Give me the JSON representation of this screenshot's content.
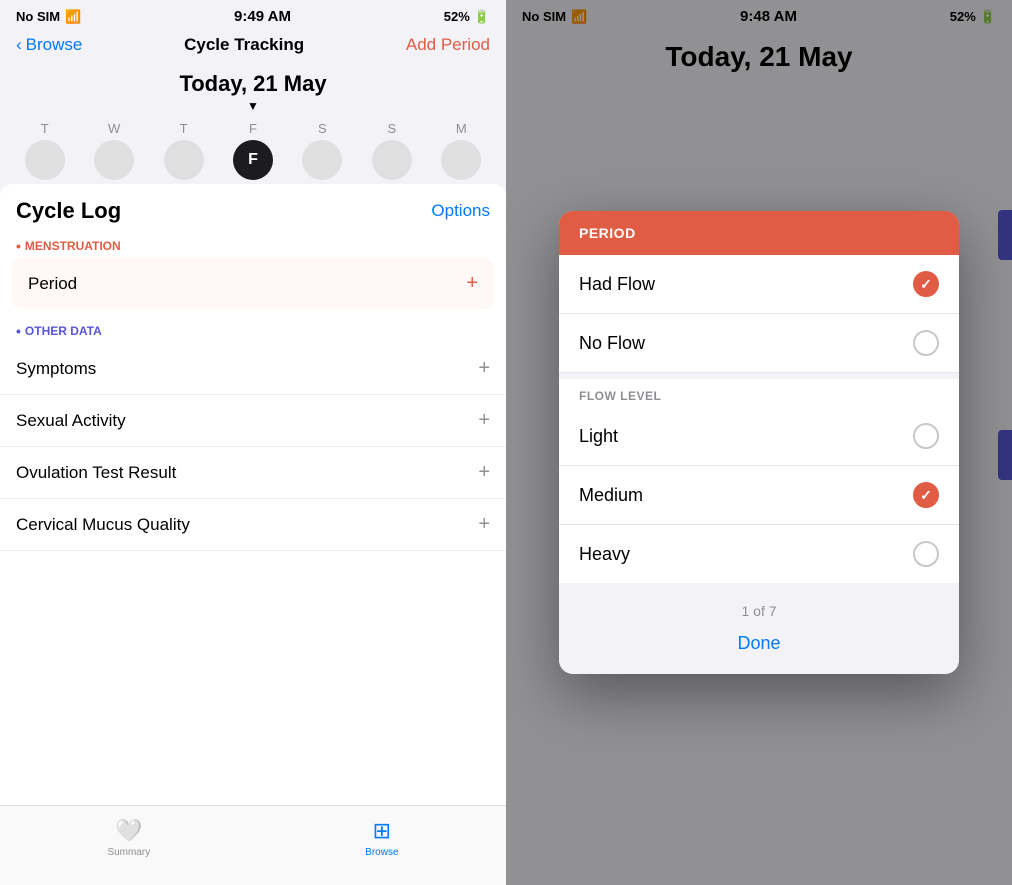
{
  "left": {
    "status": {
      "carrier": "No SIM",
      "time": "9:49 AM",
      "battery": "52%"
    },
    "nav": {
      "back_label": "Browse",
      "title": "Cycle Tracking",
      "action_label": "Add Period"
    },
    "date_header": "Today, 21 May",
    "calendar": {
      "days": [
        "T",
        "W",
        "T",
        "F",
        "S",
        "S",
        "M"
      ],
      "current_day": "F",
      "current_index": 3
    },
    "cycle_log": {
      "title": "Cycle Log",
      "options_label": "Options",
      "menstruation_label": "MENSTRUATION",
      "period_label": "Period",
      "other_data_label": "OTHER DATA",
      "other_items": [
        "Symptoms",
        "Sexual Activity",
        "Ovulation Test Result",
        "Cervical Mucus Quality"
      ]
    },
    "tabs": [
      {
        "label": "Summary",
        "icon": "♥"
      },
      {
        "label": "Browse",
        "icon": "⊞",
        "active": true
      }
    ]
  },
  "right": {
    "status": {
      "carrier": "No SIM",
      "time": "9:48 AM",
      "battery": "52%"
    },
    "date_header": "Today, 21 May",
    "modal": {
      "header_title": "PERIOD",
      "options": [
        {
          "label": "Had Flow",
          "selected": true
        },
        {
          "label": "No Flow",
          "selected": false
        }
      ],
      "flow_level_label": "FLOW LEVEL",
      "flow_options": [
        {
          "label": "Light",
          "selected": false
        },
        {
          "label": "Medium",
          "selected": true
        },
        {
          "label": "Heavy",
          "selected": false
        }
      ],
      "page_indicator": "1 of 7",
      "done_label": "Done"
    }
  }
}
